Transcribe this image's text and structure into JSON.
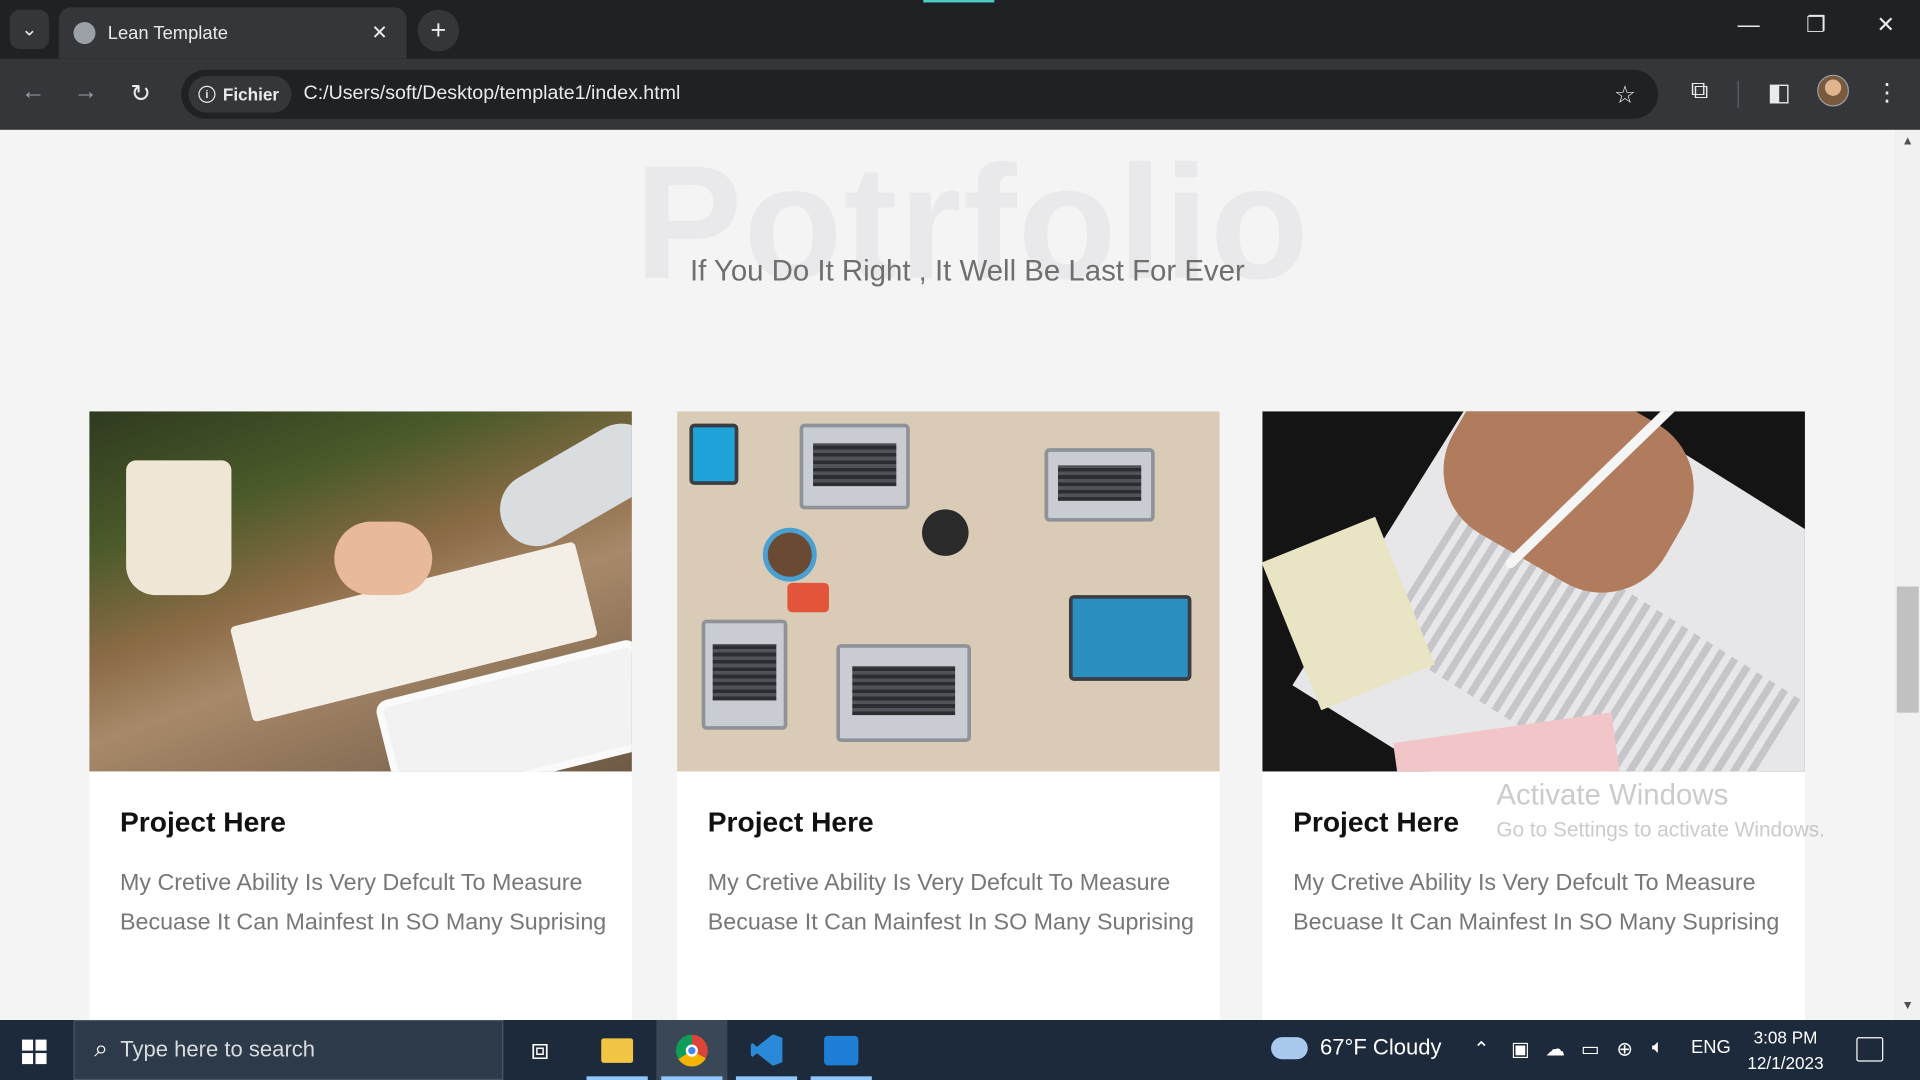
{
  "browser": {
    "tab_title": "Lean Template",
    "tab_close": "✕",
    "new_tab": "+",
    "site_chip": "Fichier",
    "url": "C:/Users/soft/Desktop/template1/index.html",
    "window_controls": [
      "—",
      "❐",
      "✕"
    ]
  },
  "page": {
    "section_bg_title": "Potrfolio",
    "section_subtitle": "If You Do It Right , It Well Be Last For Ever",
    "cards": [
      {
        "title": "Project Here",
        "text": "My Cretive Ability Is Very Defcult To Measure Becuase It Can Mainfest In SO Many Suprising"
      },
      {
        "title": "Project Here",
        "text": "My Cretive Ability Is Very Defcult To Measure Becuase It Can Mainfest In SO Many Suprising"
      },
      {
        "title": "Project Here",
        "text": "My Cretive Ability Is Very Defcult To Measure Becuase It Can Mainfest In SO Many Suprising"
      }
    ]
  },
  "watermark": {
    "line1": "Activate Windows",
    "line2": "Go to Settings to activate Windows."
  },
  "taskbar": {
    "search_placeholder": "Type here to search",
    "weather": "67°F  Cloudy",
    "language": "ENG",
    "time": "3:08 PM",
    "date": "12/1/2023"
  }
}
